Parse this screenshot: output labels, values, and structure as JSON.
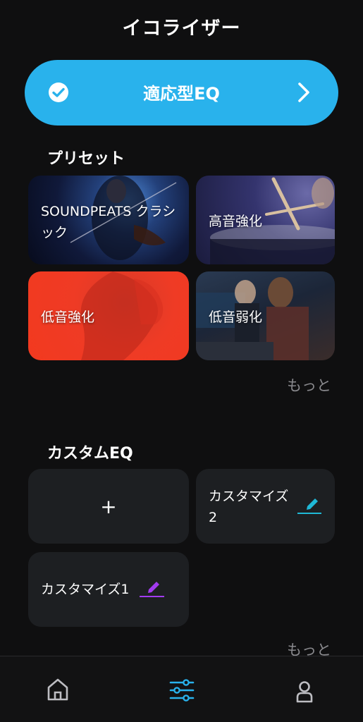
{
  "header": {
    "title": "イコライザー"
  },
  "adaptive_eq": {
    "label": "適応型EQ",
    "accent": "#29b2ec"
  },
  "presets": {
    "title": "プリセット",
    "items": [
      {
        "label": "SOUNDPEATS クラシック"
      },
      {
        "label": "高音強化"
      },
      {
        "label": "低音強化"
      },
      {
        "label": "低音弱化"
      }
    ],
    "more": "もっと"
  },
  "custom": {
    "title": "カスタムEQ",
    "add_icon": "+",
    "items": [
      {
        "label": "カスタマイズ2",
        "edit_color": "#1fb8d6"
      },
      {
        "label": "カスタマイズ1",
        "edit_color": "#a23bf0"
      }
    ],
    "more": "もっと"
  },
  "nav": {
    "items": [
      {
        "icon": "home-icon",
        "active": false
      },
      {
        "icon": "equalizer-icon",
        "active": true
      },
      {
        "icon": "profile-icon",
        "active": false
      }
    ],
    "active_color": "#29b2ec"
  }
}
